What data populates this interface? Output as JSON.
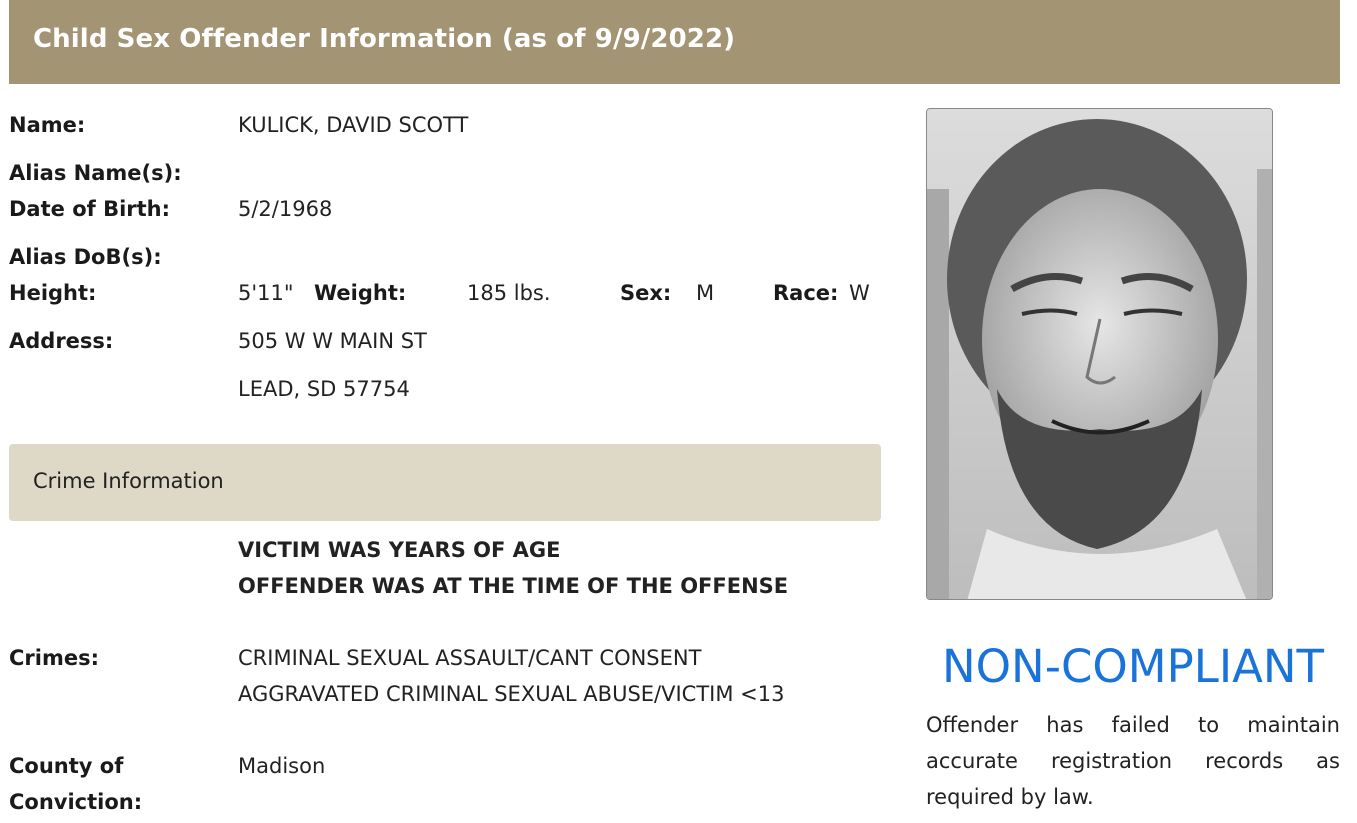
{
  "header": {
    "title": "Child Sex Offender Information (as of 9/9/2022)"
  },
  "labels": {
    "name": "Name:",
    "alias_names": "Alias Name(s):",
    "dob": "Date of Birth:",
    "alias_dob": "Alias DoB(s):",
    "height": "Height:",
    "weight": "Weight:",
    "sex": "Sex:",
    "race": "Race:",
    "address": "Address:",
    "crimes": "Crimes:",
    "county_line1": "County of",
    "county_line2": "Conviction:"
  },
  "offender": {
    "name": "KULICK, DAVID SCOTT",
    "dob": "5/2/1968",
    "height": "5'11\"",
    "weight": "185 lbs.",
    "sex": "M",
    "race": "W",
    "address_line1": "505 W W MAIN ST",
    "address_line2": "LEAD, SD 57754"
  },
  "crime_section": {
    "heading": "Crime Information",
    "victim_age": "VICTIM WAS YEARS OF AGE",
    "offender_age": "OFFENDER WAS AT THE TIME OF THE OFFENSE",
    "crimes": [
      "CRIMINAL SEXUAL ASSAULT/CANT CONSENT",
      "AGGRAVATED CRIMINAL SEXUAL ABUSE/VICTIM <13"
    ],
    "county": "Madison"
  },
  "compliance": {
    "status": "NON-COMPLIANT",
    "note": "Offender has failed to maintain accurate registration records as required by law.",
    "status_color": "#1a73d9"
  },
  "colors": {
    "header_bg": "#a39474",
    "section_bg": "#ded8c7"
  }
}
